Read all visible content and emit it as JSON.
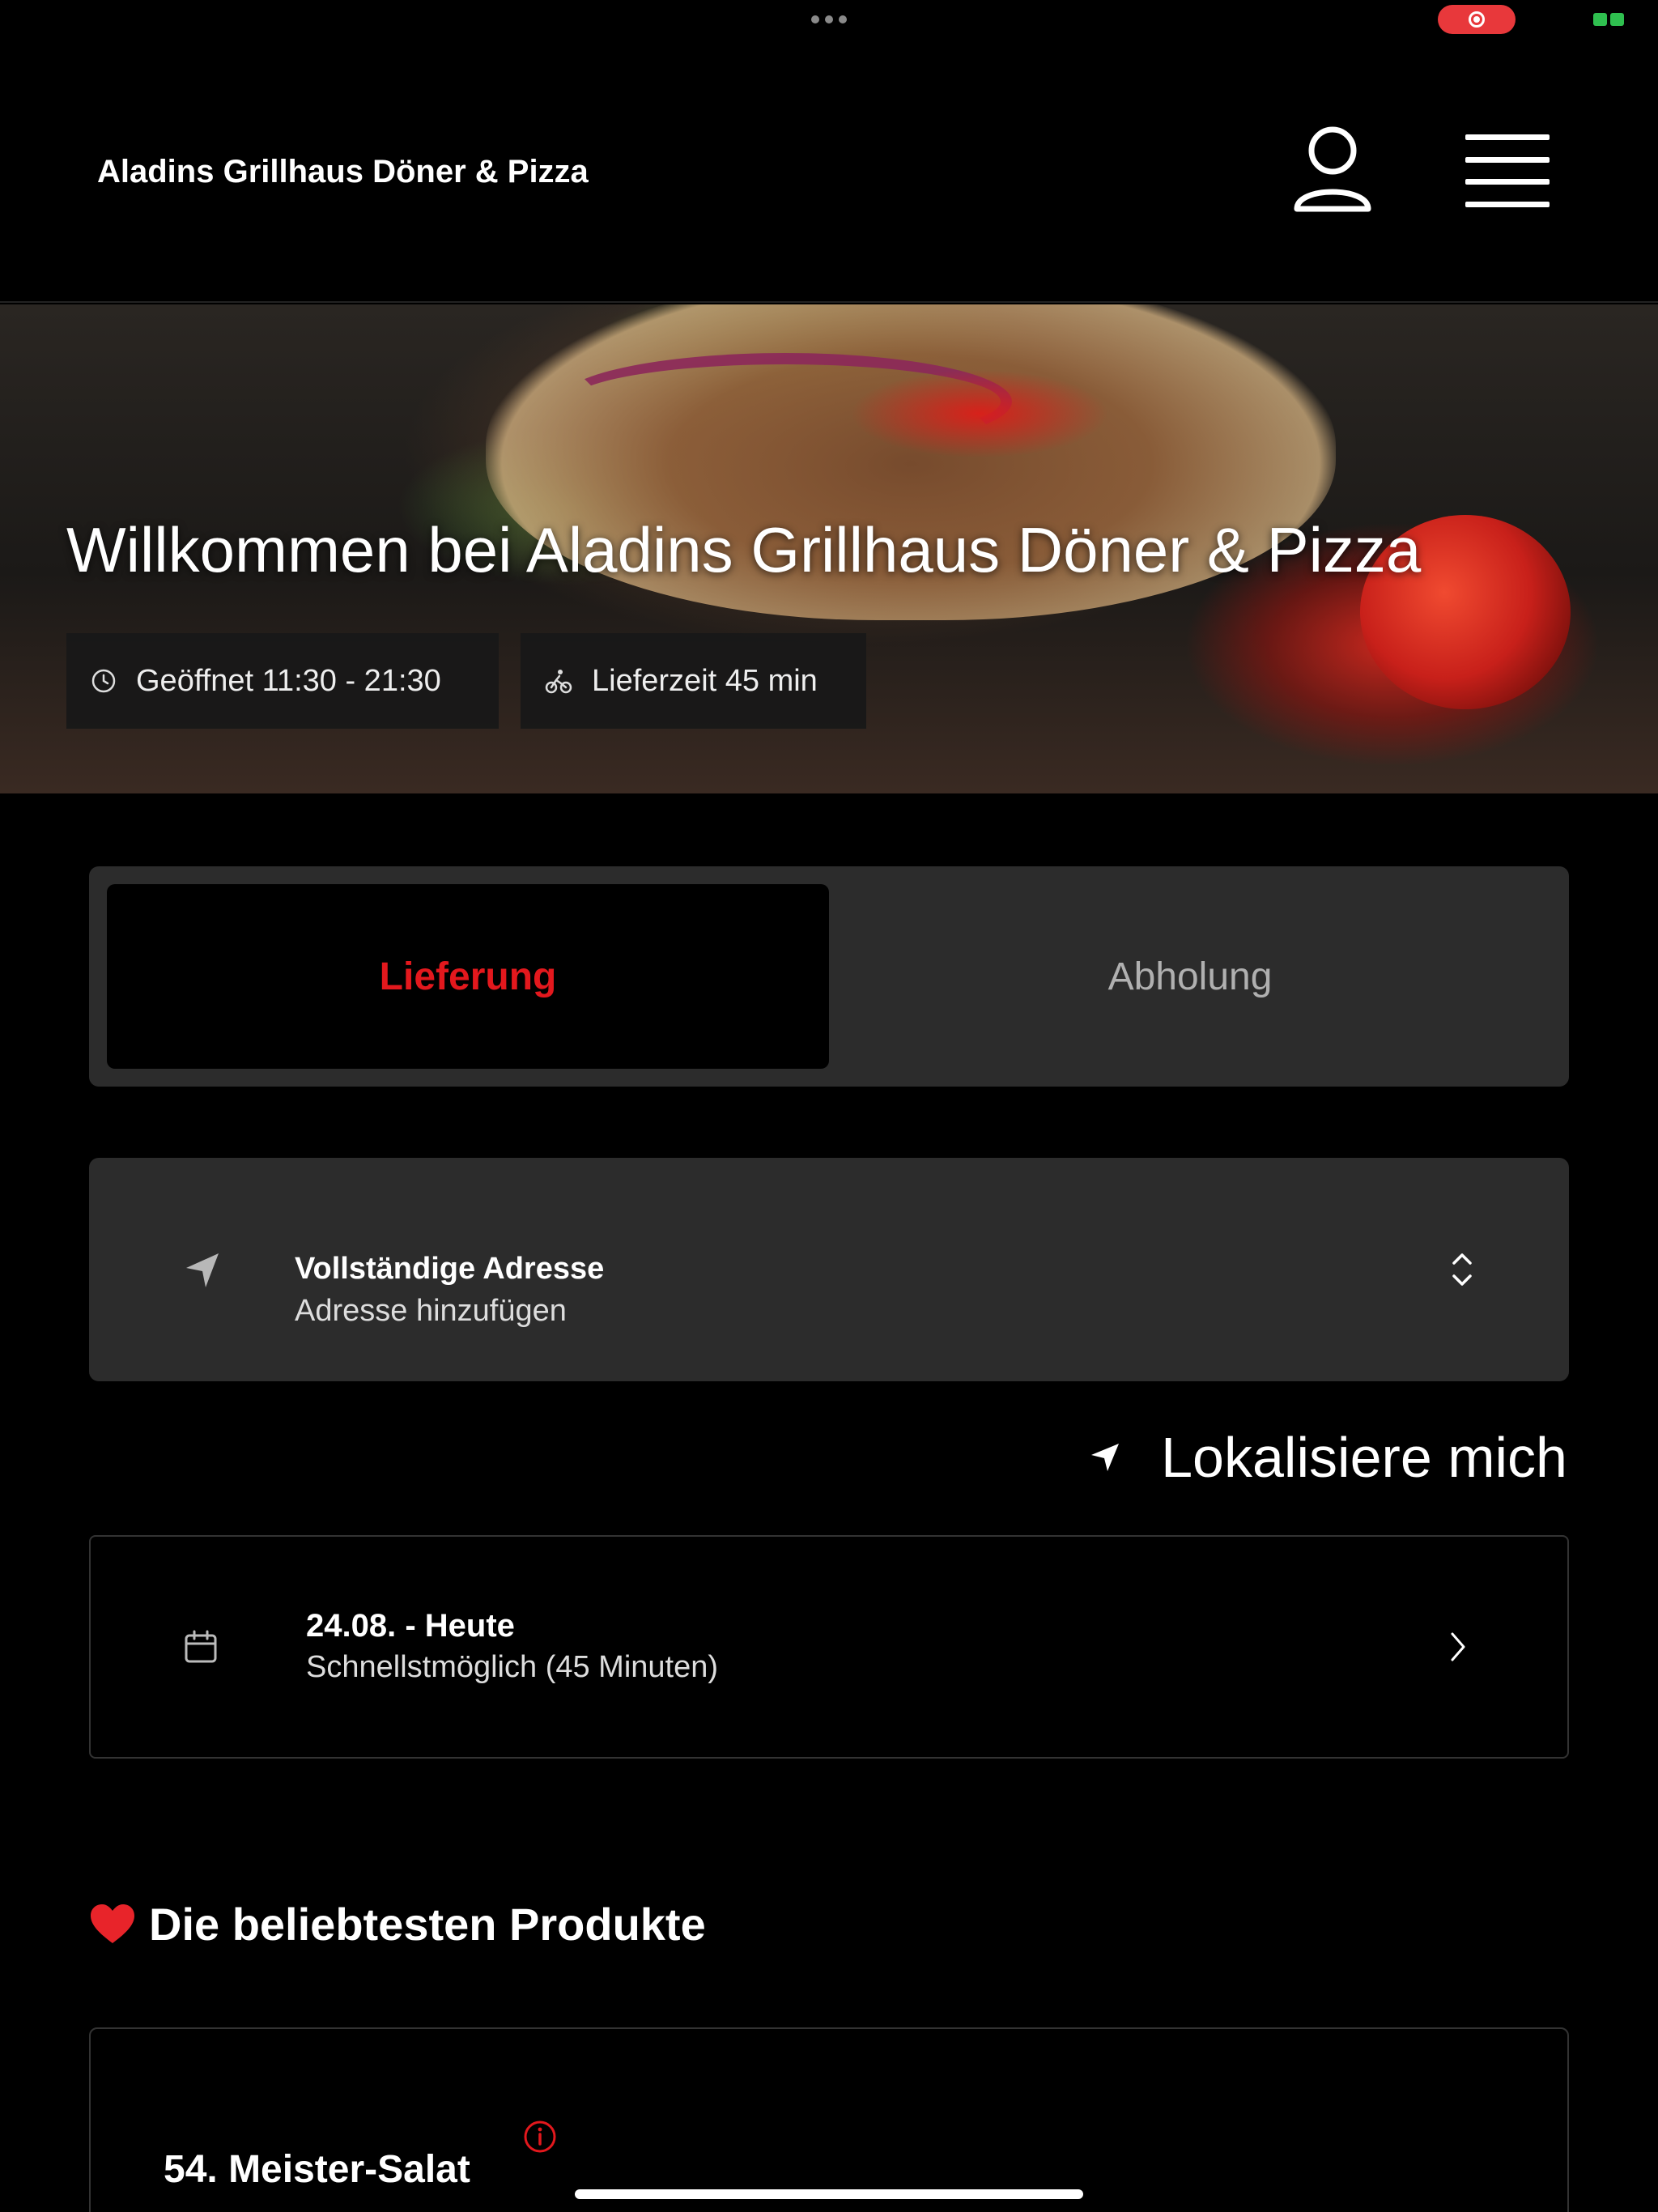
{
  "header": {
    "brand": "Aladins Grillhaus Döner & Pizza",
    "icons": {
      "user": "user-icon",
      "menu": "hamburger-menu-icon"
    }
  },
  "hero": {
    "title": "Willkommen bei Aladins Grillhaus Döner & Pizza",
    "badges": [
      {
        "icon": "clock-icon",
        "label": "Geöffnet 11:30 - 21:30"
      },
      {
        "icon": "bicycle-icon",
        "label": "Lieferzeit 45 min"
      }
    ]
  },
  "order_mode": {
    "tabs": [
      {
        "label": "Lieferung",
        "active": true
      },
      {
        "label": "Abholung",
        "active": false
      }
    ],
    "active_color": "#e3181d"
  },
  "address": {
    "icon": "navigation-arrow-icon",
    "title": "Vollständige Adresse",
    "subtitle": "Adresse hinzufügen"
  },
  "locate": {
    "icon": "navigation-arrow-icon",
    "label": "Lokalisiere mich"
  },
  "schedule": {
    "icon": "calendar-icon",
    "date": "24.08. - Heute",
    "time": "Schnellstmöglich (45 Minuten)"
  },
  "popular": {
    "icon": "heart-icon",
    "title": "Die beliebtesten Produkte",
    "products": [
      {
        "name": "54. Meister-Salat",
        "info_icon": "info-icon"
      }
    ]
  },
  "colors": {
    "background": "#000000",
    "card": "#2c2c2c",
    "accent": "#e3181d"
  }
}
